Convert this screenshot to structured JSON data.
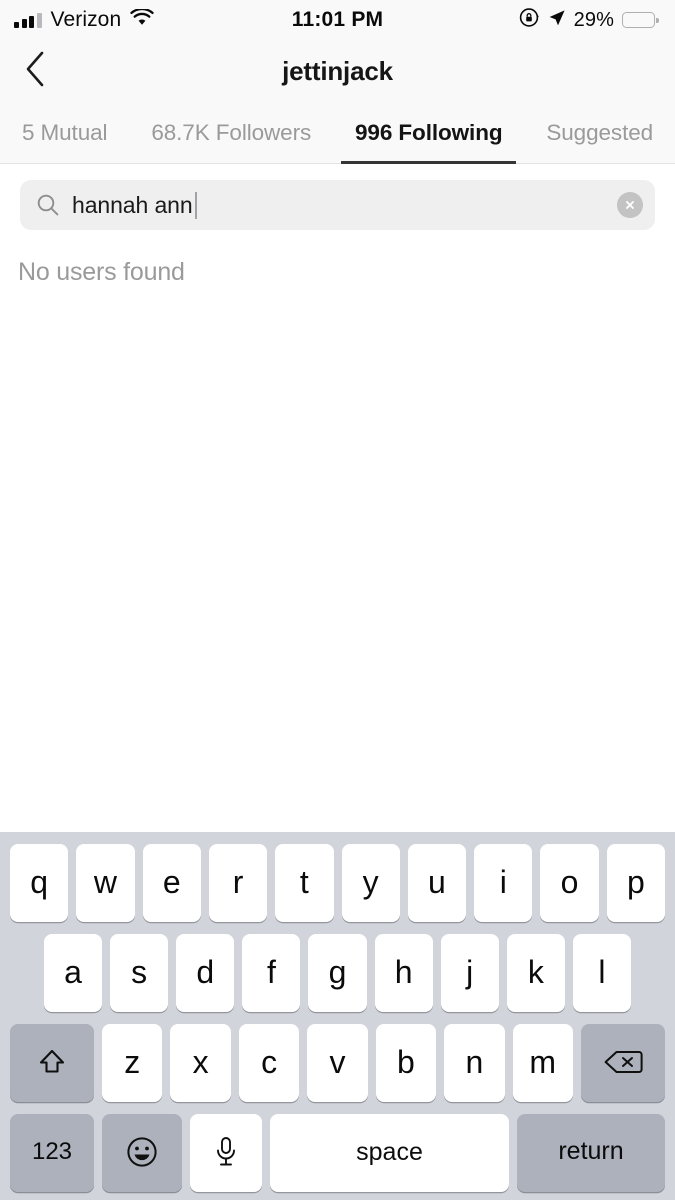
{
  "status_bar": {
    "carrier": "Verizon",
    "signal_icon": "signal-bars-icon",
    "wifi_icon": "wifi-icon",
    "time": "11:01 PM",
    "rotation_lock_icon": "rotation-lock-icon",
    "location_icon": "location-arrow-icon",
    "battery_percent": "29%",
    "battery_level": 29,
    "battery_color": "#f7c931"
  },
  "nav": {
    "back_icon": "back-chevron-icon",
    "title": "jettinjack"
  },
  "tabs": [
    {
      "label": "5 Mutual",
      "active": false
    },
    {
      "label": "68.7K Followers",
      "active": false
    },
    {
      "label": "996 Following",
      "active": true
    },
    {
      "label": "Suggested",
      "active": false
    }
  ],
  "search": {
    "icon": "search-icon",
    "value": "hannah ann",
    "placeholder": "Search",
    "clear_icon": "clear-circle-icon"
  },
  "results": {
    "empty_message": "No users found"
  },
  "keyboard": {
    "row1": [
      "q",
      "w",
      "e",
      "r",
      "t",
      "y",
      "u",
      "i",
      "o",
      "p"
    ],
    "row2": [
      "a",
      "s",
      "d",
      "f",
      "g",
      "h",
      "j",
      "k",
      "l"
    ],
    "row3": [
      "z",
      "x",
      "c",
      "v",
      "b",
      "n",
      "m"
    ],
    "shift_icon": "shift-arrow-icon",
    "backspace_icon": "backspace-icon",
    "numbers_label": "123",
    "emoji_icon": "emoji-smiley-icon",
    "mic_icon": "microphone-icon",
    "space_label": "space",
    "return_label": "return"
  },
  "colors": {
    "keyboard_bg": "#d1d4da",
    "key_light": "#ffffff",
    "key_dark": "#adb1bb",
    "search_bg": "#efefef",
    "header_bg": "#f9f9f9",
    "muted_text": "#9a9a9a",
    "active_text": "#141414"
  }
}
